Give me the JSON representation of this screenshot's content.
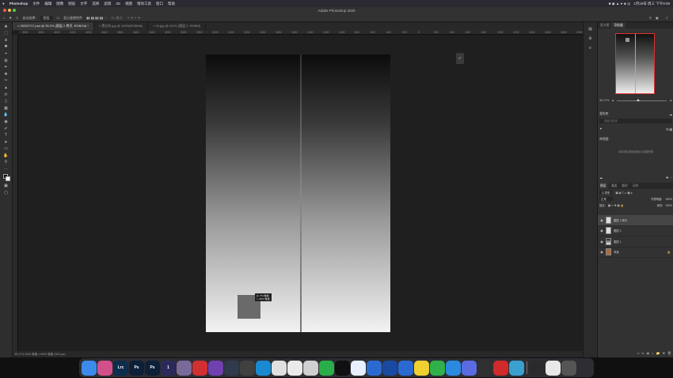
{
  "menubar": {
    "apple": "",
    "app_name": "Photoshop",
    "items": [
      "文件",
      "编辑",
      "图像",
      "图层",
      "文字",
      "选择",
      "滤镜",
      "3D",
      "视图",
      "增效工具",
      "窗口",
      "帮助"
    ],
    "datetime": "1月19日 周三 下午9:09"
  },
  "window": {
    "title": "Adobe Photoshop 2020"
  },
  "options_bar": {
    "auto_select_label": "自动选择:",
    "auto_select_value": "图层",
    "transform_label": "显示变换控件",
    "mode_3d": "3D 模式:"
  },
  "doc_tabs": [
    {
      "label": "20220717.psd @ 35.2% (图层 2 拷贝, RGB/16) *",
      "active": true
    },
    {
      "label": "黑白灰.jpg @ 100%(RGB/8#)",
      "active": false
    },
    {
      "label": "01.jpg @ 112% (图层 2, RGB/8)",
      "active": false
    }
  ],
  "ruler_ticks": [
    "5000",
    "4800",
    "4600",
    "4400",
    "4200",
    "4000",
    "3800",
    "3600",
    "3400",
    "3200",
    "3000",
    "2800",
    "2600",
    "2400",
    "2200",
    "2000",
    "1800",
    "1600",
    "1400",
    "1200",
    "1000",
    "800",
    "600",
    "400",
    "200",
    "0",
    "200",
    "400",
    "600",
    "800",
    "1000",
    "1200",
    "1400",
    "1600",
    "1800",
    "2000"
  ],
  "canvas": {
    "tooltip_line1": "H: 774 像素",
    "tooltip_line2": "↓: 4471 像素"
  },
  "status_bar": {
    "text": "35.17%   3000 像素 x 6000 像素 (300 ppi)"
  },
  "navigator": {
    "tabs": [
      "直方图",
      "导航器"
    ],
    "zoom": "35.17%"
  },
  "libraries": {
    "title": "我的库",
    "search_placeholder": "搜索当前库",
    "section": "库视图",
    "empty_text": "将库添加到此面板以创建资源"
  },
  "layers_panel": {
    "tabs": [
      "图层",
      "通道",
      "路径",
      "动作"
    ],
    "filter": "Q 类型",
    "blend_mode": "正常",
    "opacity_label": "不透明度:",
    "opacity": "100%",
    "lock_label": "锁定:",
    "fill_label": "填充:",
    "fill": "100%",
    "layers": [
      {
        "name": "图层 2 拷贝",
        "selected": true,
        "thumb": "white"
      },
      {
        "name": "图层 2",
        "selected": false,
        "thumb": "white"
      },
      {
        "name": "图层 1",
        "selected": false,
        "thumb": "grad"
      },
      {
        "name": "背景",
        "selected": false,
        "thumb": "bg"
      }
    ]
  },
  "dock": [
    {
      "name": "finder-icon",
      "label": "",
      "color": "#3b8bea"
    },
    {
      "name": "launchpad-icon",
      "label": "",
      "color": "#d2508a"
    },
    {
      "name": "lightroom-classic-icon",
      "label": "Lrc",
      "color": "#0d2d4d"
    },
    {
      "name": "photoshop-icon",
      "label": "Ps",
      "color": "#0d2038"
    },
    {
      "name": "photoshop-2-icon",
      "label": "Ps",
      "color": "#0d2038"
    },
    {
      "name": "one-icon",
      "label": "1",
      "color": "#2a2a5a"
    },
    {
      "name": "app-icon",
      "label": "",
      "color": "#7a6a9a"
    },
    {
      "name": "cast-icon",
      "label": "",
      "color": "#d03030"
    },
    {
      "name": "bird-icon",
      "label": "",
      "color": "#7040b0"
    },
    {
      "name": "davinci-icon",
      "label": "",
      "color": "#303a4a"
    },
    {
      "name": "final-cut-icon",
      "label": "",
      "color": "#404040"
    },
    {
      "name": "edge-icon",
      "label": "",
      "color": "#1a8ad0"
    },
    {
      "name": "app2-icon",
      "label": "",
      "color": "#e0e0e0"
    },
    {
      "name": "feather-icon",
      "label": "",
      "color": "#eaeaea"
    },
    {
      "name": "chrome-icon",
      "label": "",
      "color": "#d0d0d0"
    },
    {
      "name": "wechat-icon",
      "label": "",
      "color": "#2aae4a"
    },
    {
      "name": "qq-icon",
      "label": "",
      "color": "#101010"
    },
    {
      "name": "app3-icon",
      "label": "",
      "color": "#e8f0ff"
    },
    {
      "name": "baidu-icon",
      "label": "",
      "color": "#2a6ad0"
    },
    {
      "name": "video-icon",
      "label": "",
      "color": "#1a4aa0"
    },
    {
      "name": "app4-icon",
      "label": "",
      "color": "#2a6ad0"
    },
    {
      "name": "app5-icon",
      "label": "",
      "color": "#f0d030"
    },
    {
      "name": "app6-icon",
      "label": "",
      "color": "#30b04a"
    },
    {
      "name": "app7-icon",
      "label": "",
      "color": "#2a8ae0"
    },
    {
      "name": "app8-icon",
      "label": "",
      "color": "#5a6ae0"
    },
    {
      "name": "app9-icon",
      "label": "",
      "color": "#303030"
    },
    {
      "name": "netease-icon",
      "label": "",
      "color": "#d02a2a"
    },
    {
      "name": "app10-icon",
      "label": "",
      "color": "#3aa0d0"
    }
  ],
  "dock_right": [
    {
      "name": "folder-icon",
      "label": "",
      "color": "#2a2a2a"
    },
    {
      "name": "window-icon",
      "label": "",
      "color": "#e8e8e8"
    },
    {
      "name": "trash-icon",
      "label": "",
      "color": "#555"
    }
  ]
}
